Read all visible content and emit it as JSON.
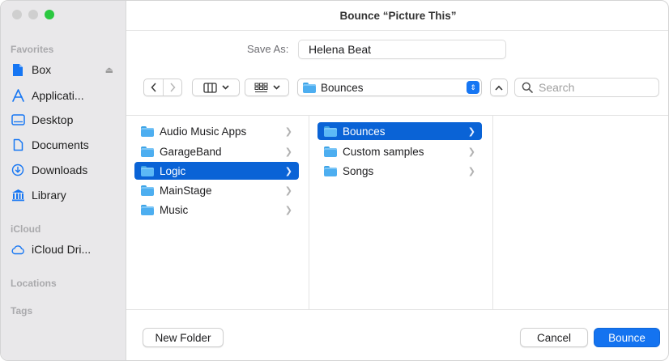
{
  "window": {
    "title": "Bounce “Picture This”"
  },
  "sidebar": {
    "favorites_label": "Favorites",
    "favorites": [
      {
        "label": "Box",
        "icon": "file-icon"
      },
      {
        "label": "Applicati...",
        "icon": "applications-icon"
      },
      {
        "label": "Desktop",
        "icon": "desktop-icon"
      },
      {
        "label": "Documents",
        "icon": "document-icon"
      },
      {
        "label": "Downloads",
        "icon": "download-icon"
      },
      {
        "label": "Library",
        "icon": "library-icon"
      }
    ],
    "icloud_label": "iCloud",
    "icloud": [
      {
        "label": "iCloud Dri...",
        "icon": "cloud-icon"
      }
    ],
    "locations_label": "Locations",
    "tags_label": "Tags"
  },
  "save_as": {
    "label": "Save As:",
    "value": "Helena Beat"
  },
  "toolbar": {
    "location": "Bounces",
    "search_placeholder": "Search"
  },
  "columns": {
    "col1": [
      {
        "label": "Audio Music Apps",
        "selected": false
      },
      {
        "label": "GarageBand",
        "selected": false
      },
      {
        "label": "Logic",
        "selected": true
      },
      {
        "label": "MainStage",
        "selected": false
      },
      {
        "label": "Music",
        "selected": false
      }
    ],
    "col2": [
      {
        "label": "Bounces",
        "selected": true
      },
      {
        "label": "Custom samples",
        "selected": false
      },
      {
        "label": "Songs",
        "selected": false
      }
    ]
  },
  "buttons": {
    "new_folder": "New Folder",
    "cancel": "Cancel",
    "bounce": "Bounce"
  },
  "colors": {
    "accent": "#1473f0",
    "selection": "#0a63d6",
    "sidebar": "#e9e8ea"
  }
}
